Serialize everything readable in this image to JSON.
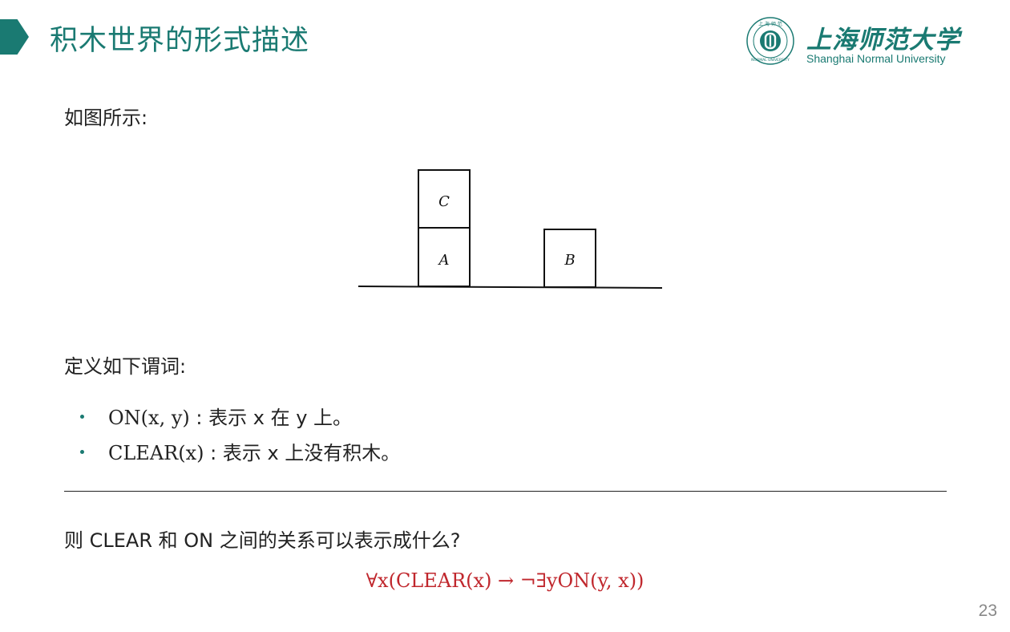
{
  "header": {
    "title": "积木世界的形式描述",
    "logo_cn": "上海师范大学",
    "logo_en": "Shanghai Normal University",
    "logo_seal_text": "SHANGHAI NORMAL UNIVERSITY"
  },
  "body": {
    "intro": "如图所示:",
    "figure": {
      "blocks": [
        {
          "label": "C"
        },
        {
          "label": "A"
        },
        {
          "label": "B"
        }
      ]
    },
    "definitions_intro": "定义如下谓词:",
    "bullets": [
      {
        "term": "ON(x, y)",
        "text": " : 表示 x 在 y 上。"
      },
      {
        "term": "CLEAR(x)",
        "text": " : 表示 x 上没有积木。"
      }
    ],
    "question": "则 CLEAR 和 ON 之间的关系可以表示成什么?",
    "answer": "∀x(CLEAR(x) → ¬∃yON(y, x))"
  },
  "footer": {
    "page_number": "23"
  },
  "colors": {
    "accent": "#1a7a72",
    "answer": "#c0272d"
  }
}
